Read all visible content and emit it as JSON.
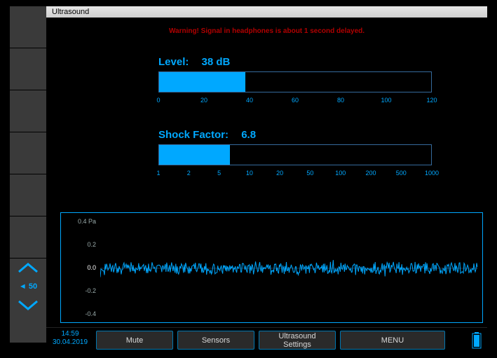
{
  "title": "Ultrasound",
  "warning": "Warning! Signal in headphones is about 1 second delayed.",
  "sidebar": {
    "value": "◄ 50"
  },
  "level": {
    "label": "Level:",
    "value": "38 dB",
    "max": 120,
    "fill_pct": 31.7,
    "ticks": [
      "0",
      "20",
      "40",
      "60",
      "80",
      "100",
      "120"
    ],
    "tick_pos": [
      0,
      16.67,
      33.33,
      50,
      66.67,
      83.33,
      100
    ]
  },
  "shock": {
    "label": "Shock Factor:",
    "value": "6.8",
    "fill_pct": 26.0,
    "ticks": [
      "1",
      "2",
      "5",
      "10",
      "20",
      "50",
      "100",
      "200",
      "500",
      "1000"
    ],
    "tick_pos": [
      0,
      11.1,
      22.2,
      33.3,
      44.4,
      55.5,
      66.6,
      77.7,
      88.8,
      100
    ]
  },
  "wave": {
    "unit": "Pa",
    "yticks": [
      {
        "label": "0.4",
        "pos_pct": 8
      },
      {
        "label": "0.2",
        "pos_pct": 29
      },
      {
        "label": "0.0",
        "pos_pct": 50
      },
      {
        "label": "-0.2",
        "pos_pct": 71
      },
      {
        "label": "-0.4",
        "pos_pct": 92
      }
    ]
  },
  "footer": {
    "time": "14:59",
    "date": "30.04.2019",
    "buttons": {
      "mute": "Mute",
      "sensors": "Sensors",
      "settings": "Ultrasound\nSettings",
      "menu": "MENU"
    }
  },
  "colors": {
    "accent": "#00a8ff",
    "warn": "#b00000"
  },
  "chart_data": {
    "type": "line",
    "title": "Ultrasound time signal",
    "xlabel": "",
    "ylabel": "Pa",
    "ylim": [
      -0.5,
      0.5
    ],
    "series": [
      {
        "name": "signal",
        "description": "dense noisy oscillation mostly within ±0.1 Pa with occasional spikes up to ~±0.2 Pa, centered on 0"
      }
    ]
  }
}
